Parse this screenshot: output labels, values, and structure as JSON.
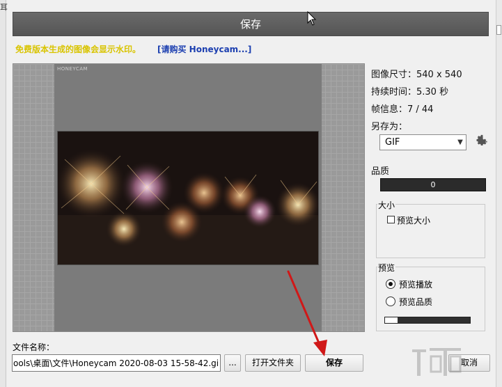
{
  "background": {
    "left_glyph": "耳"
  },
  "dialog": {
    "title": "保存",
    "watermark_notice": "免费版本生成的图像会显示水印。",
    "buy_link": "[请购买 Honeycam...]"
  },
  "preview": {
    "watermark_text": "HONEYCAM"
  },
  "info": {
    "size": "图像尺寸：540 x 540",
    "duration": "持续时间：5.30 秒",
    "frames": "帧信息：7 / 44",
    "save_as_label": "另存为：",
    "format_value": "GIF",
    "quality_label": "品质",
    "quality_value": "0"
  },
  "size_group": {
    "label": "大小",
    "preview_size_label": "预览大小",
    "preview_size_checked": false
  },
  "preview_group": {
    "label": "预览",
    "play_label": "预览播放",
    "quality_label": "预览品质",
    "selected": "play",
    "progress": 0.15
  },
  "bottom": {
    "filename_label": "文件名称：",
    "filename_value": "ools\\桌面\\文件\\Honeycam 2020-08-03 15-58-42.gif",
    "browse_label": "...",
    "open_folder_label": "打开文件夹",
    "save_label": "保存",
    "cancel_label": "取消"
  },
  "colors": {
    "notice": "#d9c400",
    "link": "#1c3fb0",
    "annotation_arrow": "#d01818"
  },
  "icons": [
    "gear-icon",
    "mouse-cursor-icon",
    "red-arrow-annotation",
    "dropdown-arrow-icon"
  ]
}
